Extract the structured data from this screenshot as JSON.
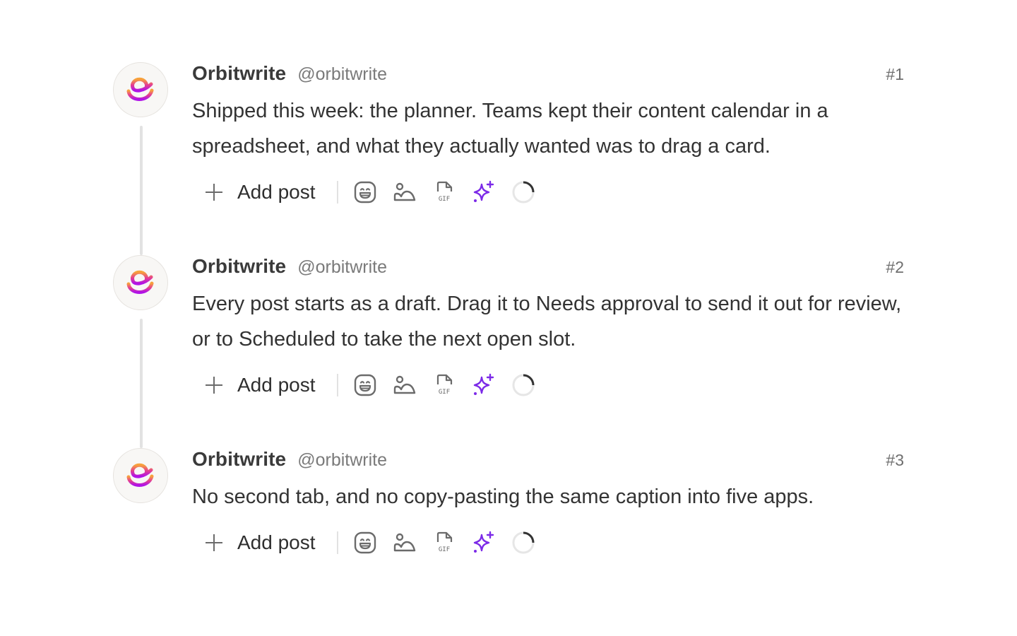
{
  "posts": [
    {
      "author": "Orbitwrite",
      "handle": "@orbitwrite",
      "number": "#1",
      "text": "Shipped this week: the planner. Teams kept their content calendar in a spreadsheet, and what they actually wanted was to drag a card.",
      "toolbar": {
        "add_label": "Add post",
        "tools": [
          "emoji-icon",
          "image-icon",
          "gif-icon",
          "ai-sparkle-icon",
          "char-count-ring-icon"
        ]
      }
    },
    {
      "author": "Orbitwrite",
      "handle": "@orbitwrite",
      "number": "#2",
      "text": "Every post starts as a draft. Drag it to Needs approval to send it out for review, or to Scheduled to take the next open slot.",
      "toolbar": {
        "add_label": "Add post",
        "tools": [
          "emoji-icon",
          "image-icon",
          "gif-icon",
          "ai-sparkle-icon",
          "char-count-ring-icon"
        ]
      }
    },
    {
      "author": "Orbitwrite",
      "handle": "@orbitwrite",
      "number": "#3",
      "text": "No second tab, and no copy-pasting the same caption into five apps.",
      "toolbar": {
        "add_label": "Add post",
        "tools": [
          "emoji-icon",
          "image-icon",
          "gif-icon",
          "ai-sparkle-icon",
          "char-count-ring-icon"
        ]
      }
    }
  ],
  "icons": {
    "gif_label": "GIF"
  },
  "colors": {
    "accent_sparkle": "#7c2ae8",
    "logo_gradient_start": "#f7a23b",
    "logo_gradient_end": "#b012e8",
    "connector": "#e2e2e2",
    "ring_progress": "#333333",
    "ring_track": "#e6e6e6"
  }
}
